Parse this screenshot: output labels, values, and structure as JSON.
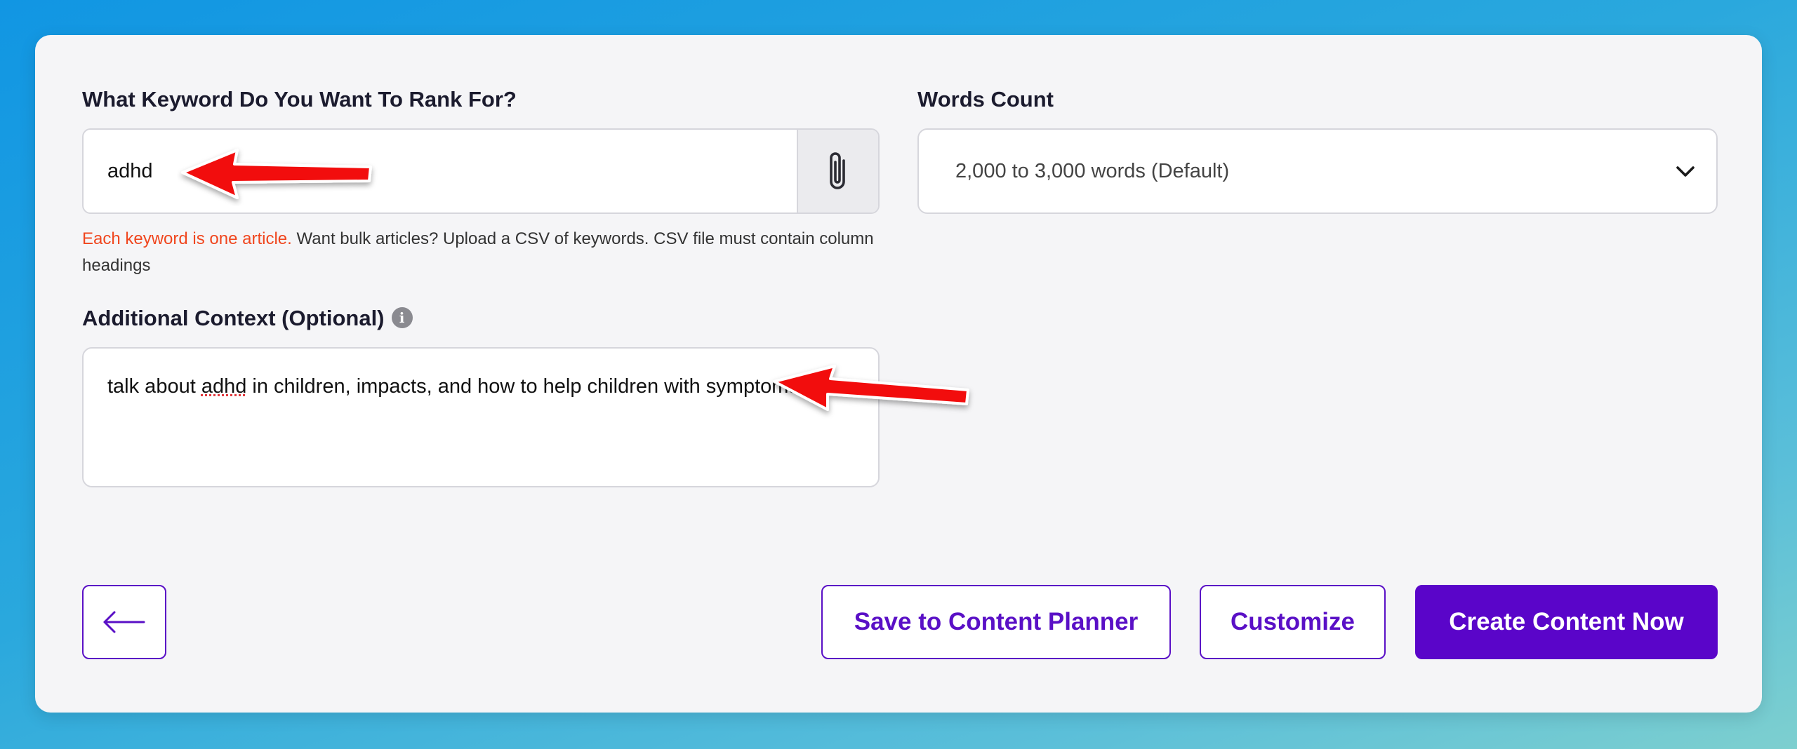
{
  "form": {
    "keyword_label": "What Keyword Do You Want To Rank For?",
    "keyword_value": "adhd",
    "hint_red": "Each keyword is one article.",
    "hint_rest": " Want bulk articles? Upload a CSV of keywords. CSV file must contain column headings",
    "context_label": "Additional Context (Optional)",
    "info_glyph": "i",
    "context_before": "talk about ",
    "context_misspelled": "adhd",
    "context_after": " in children, impacts, and how to help children with symptoms",
    "words_label": "Words Count",
    "words_value": "2,000 to 3,000 words (Default)"
  },
  "actions": {
    "save_label": "Save to Content Planner",
    "customize_label": "Customize",
    "create_label": "Create Content Now"
  },
  "icons": {
    "attach": "paperclip-icon",
    "info": "info-icon",
    "dropdown": "chevron-down-icon",
    "back": "arrow-left-icon"
  },
  "colors": {
    "accent": "#5a05c9",
    "hint_red": "#f0461e",
    "annotation_arrow": "#f20d0d"
  }
}
